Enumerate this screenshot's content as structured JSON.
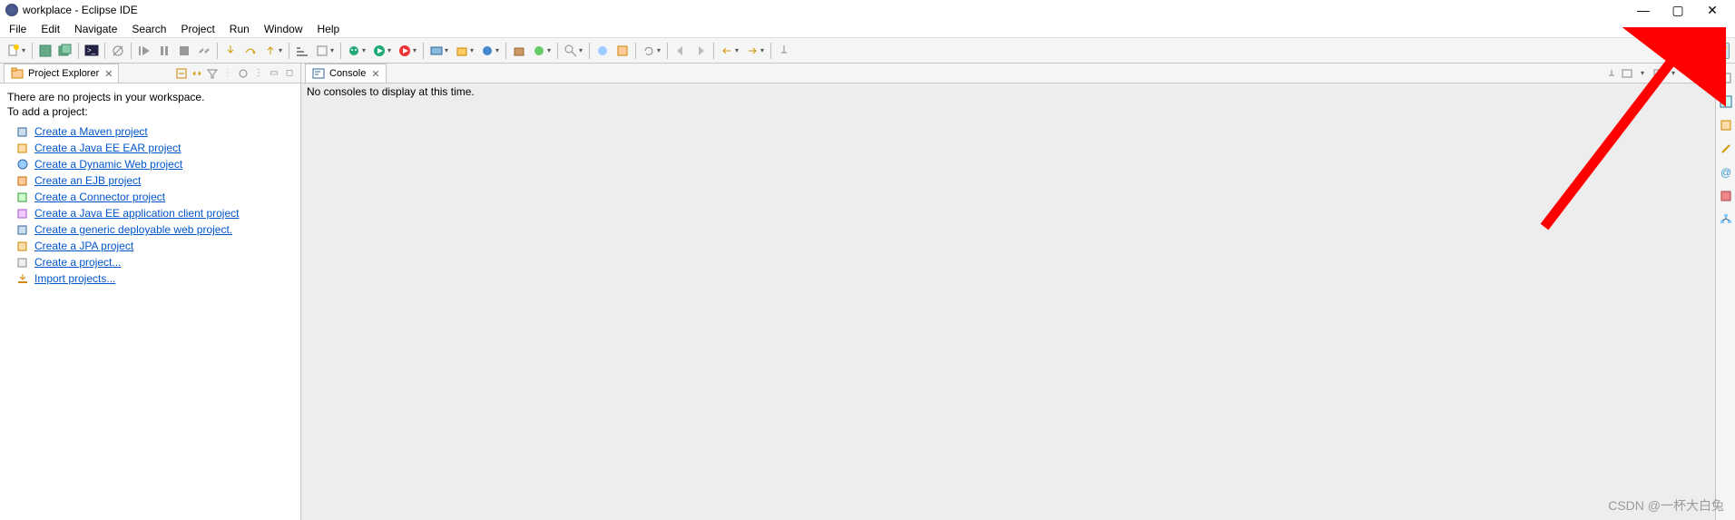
{
  "title": "workplace - Eclipse IDE",
  "window_controls": {
    "min": "—",
    "max": "▢",
    "close": "✕"
  },
  "menu": [
    "File",
    "Edit",
    "Navigate",
    "Search",
    "Project",
    "Run",
    "Window",
    "Help"
  ],
  "left_pane": {
    "tab_label": "Project Explorer",
    "no_projects_msg": "There are no projects in your workspace.",
    "to_add_msg": "To add a project:",
    "links": [
      "Create a Maven project",
      "Create a Java EE EAR project",
      "Create a Dynamic Web project",
      "Create an EJB project",
      "Create a Connector project",
      "Create a Java EE application client project",
      "Create a generic deployable web project.",
      "Create a JPA project",
      "Create a project...",
      "Import projects..."
    ]
  },
  "console": {
    "tab_label": "Console",
    "empty_msg": "No consoles to display at this time."
  },
  "watermark": "CSDN @一杯大白兔"
}
